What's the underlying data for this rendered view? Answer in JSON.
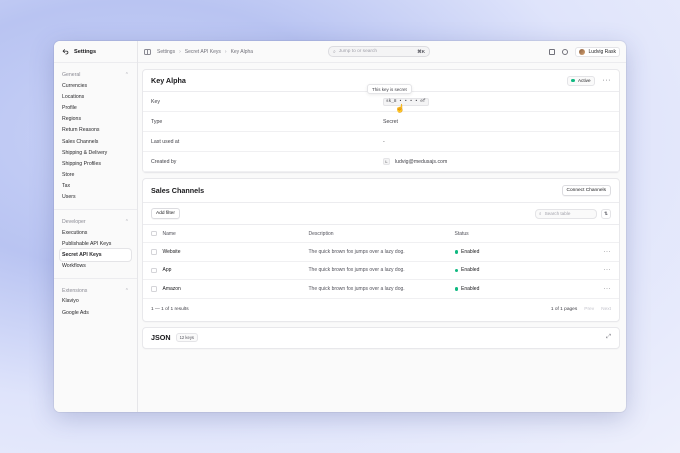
{
  "sidebar": {
    "title": "Settings",
    "groups": [
      {
        "title": "General",
        "items": [
          "Currencies",
          "Locations",
          "Profile",
          "Regions",
          "Return Reasons",
          "Sales Channels",
          "Shipping & Delivery",
          "Shipping Profiles",
          "Store",
          "Tax",
          "Users"
        ]
      },
      {
        "title": "Developer",
        "items": [
          "Executions",
          "Publishable API Keys",
          "Secret API Keys",
          "Workflows"
        ]
      },
      {
        "title": "Extensions",
        "items": [
          "Klaviyo",
          "Google Ads"
        ]
      }
    ],
    "active_item": "Secret API Keys"
  },
  "topbar": {
    "breadcrumbs": [
      "Settings",
      "Secret API Keys",
      "Key Alpha"
    ],
    "search_placeholder": "Jump to or search",
    "search_shortcut": "⌘K",
    "user_name": "Ludvig Rask"
  },
  "key_card": {
    "title": "Key Alpha",
    "status": "Active",
    "tooltip": "This key is secret",
    "rows": [
      {
        "label": "Key",
        "value": "sk_8 • • • • ef"
      },
      {
        "label": "Type",
        "value": "Secret"
      },
      {
        "label": "Last used at",
        "value": "-"
      },
      {
        "label": "Created by",
        "initial": "L",
        "value": "ludvig@medusajs.com"
      }
    ]
  },
  "sales_channels": {
    "title": "Sales Channels",
    "connect_label": "Connect Channels",
    "add_filter_label": "Add filter",
    "search_placeholder": "Search table",
    "columns": {
      "name": "Name",
      "description": "Description",
      "status": "Status"
    },
    "rows": [
      {
        "name": "Website",
        "description": "The quick brown fox jumps over a lazy dog.",
        "status": "Enabled"
      },
      {
        "name": "App",
        "description": "The quick brown fox jumps over a lazy dog.",
        "status": "Enabled"
      },
      {
        "name": "Amazon",
        "description": "The quick brown fox jumps over a lazy dog.",
        "status": "Enabled"
      }
    ],
    "pagination": {
      "range": "1 — 1 of 1 results",
      "pages": "1 of 1 pages",
      "prev": "Prev",
      "next": "Next"
    }
  },
  "json_card": {
    "title": "JSON",
    "badge": "12 keys"
  },
  "colors": {
    "accent_status": "#10b981",
    "background": "#c9d2f7"
  }
}
